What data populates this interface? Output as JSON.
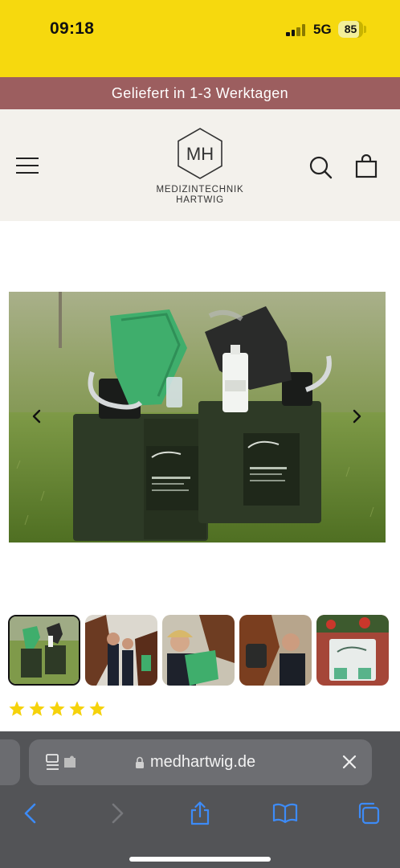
{
  "status_bar": {
    "time": "09:18",
    "network": "5G",
    "battery": "85",
    "battery_level": 0.85
  },
  "announcement": {
    "text": "Geliefert in 1-3 Werktagen"
  },
  "header": {
    "logo_monogram": "MH",
    "logo_line1": "MEDIZINTECHNIK",
    "logo_line2": "HARTWIG",
    "icons": [
      "menu-icon",
      "search-icon",
      "bag-icon"
    ]
  },
  "gallery": {
    "thumbnail_count": 5,
    "active_thumbnail": 1
  },
  "rating": {
    "stars": 5,
    "star_color": "#f5d20b"
  },
  "browser": {
    "url": "medhartwig.de"
  },
  "colors": {
    "status_bar": "#f6d90e",
    "announcement": "#9c5e5f",
    "header_bg": "#f3f1ec",
    "browser_chrome": "#535457",
    "browser_accent": "#3d8bf7"
  }
}
